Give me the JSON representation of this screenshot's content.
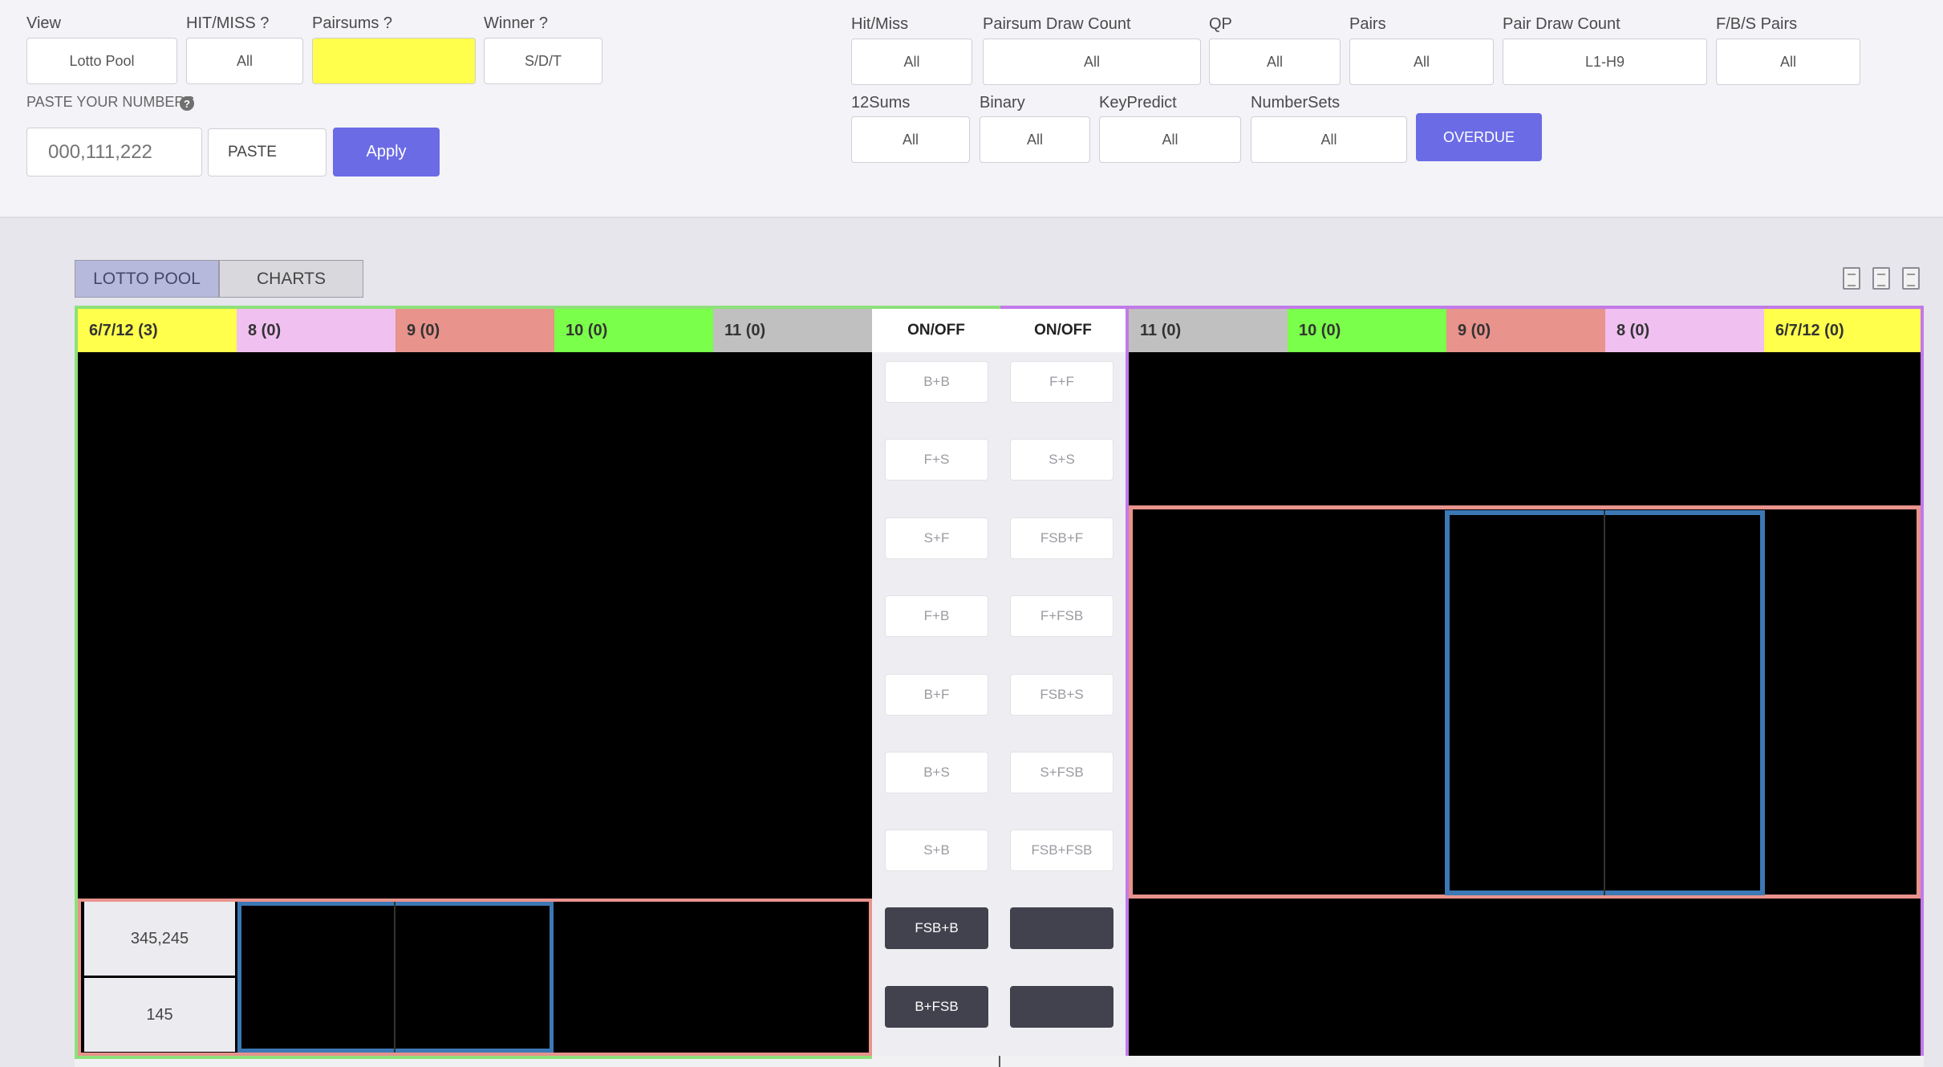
{
  "filters_left": {
    "view": {
      "label": "View",
      "value": "Lotto Pool"
    },
    "hitmiss": {
      "label": "HIT/MISS ?",
      "value": "All"
    },
    "pairsums": {
      "label": "Pairsums ?",
      "value": ""
    },
    "winner": {
      "label": "Winner ?",
      "value": "S/D/T"
    },
    "paste_label": "PASTE YOUR NUMBERS",
    "numbers_placeholder": "000,111,222",
    "paste_button": "PASTE",
    "apply_button": "Apply"
  },
  "filters_right": {
    "row1": [
      {
        "label": "Hit/Miss",
        "value": "All"
      },
      {
        "label": "Pairsum Draw Count",
        "value": "All"
      },
      {
        "label": "QP",
        "value": "All"
      },
      {
        "label": "Pairs",
        "value": "All"
      },
      {
        "label": "Pair Draw Count",
        "value": "L1-H9"
      },
      {
        "label": "F/B/S Pairs",
        "value": "All"
      }
    ],
    "row2": [
      {
        "label": "12Sums",
        "value": "All"
      },
      {
        "label": "Binary",
        "value": "All"
      },
      {
        "label": "KeyPredict",
        "value": "All"
      },
      {
        "label": "NumberSets",
        "value": "All"
      }
    ],
    "overdue_button": "OVERDUE"
  },
  "tabs": {
    "lotto_pool": "LOTTO POOL",
    "charts": "CHARTS"
  },
  "left_columns": [
    "6/7/12 (3)",
    "8 (0)",
    "9 (0)",
    "10 (0)",
    "11 (0)"
  ],
  "right_columns": [
    "11 (0)",
    "10 (0)",
    "9 (0)",
    "8 (0)",
    "6/7/12 (0)"
  ],
  "column_colors": {
    "c6712": "#ffff4c",
    "c8": "#f0c0f0",
    "c9": "#e8938c",
    "c10": "#7aff4a",
    "c11": "#c0c0c0"
  },
  "controls": {
    "header_left": "ON/OFF",
    "header_right": "ON/OFF",
    "left_buttons": [
      "B+B",
      "F+S",
      "S+F",
      "F+B",
      "B+F",
      "B+S",
      "S+B",
      "FSB+B",
      "B+FSB"
    ],
    "right_buttons": [
      "F+F",
      "S+S",
      "FSB+F",
      "F+FSB",
      "FSB+S",
      "S+FSB",
      "FSB+FSB",
      "",
      ""
    ]
  },
  "left_bottom_rows": [
    "345,245",
    "145"
  ],
  "icons": [
    "help-icon",
    "copy-doc-icon"
  ]
}
